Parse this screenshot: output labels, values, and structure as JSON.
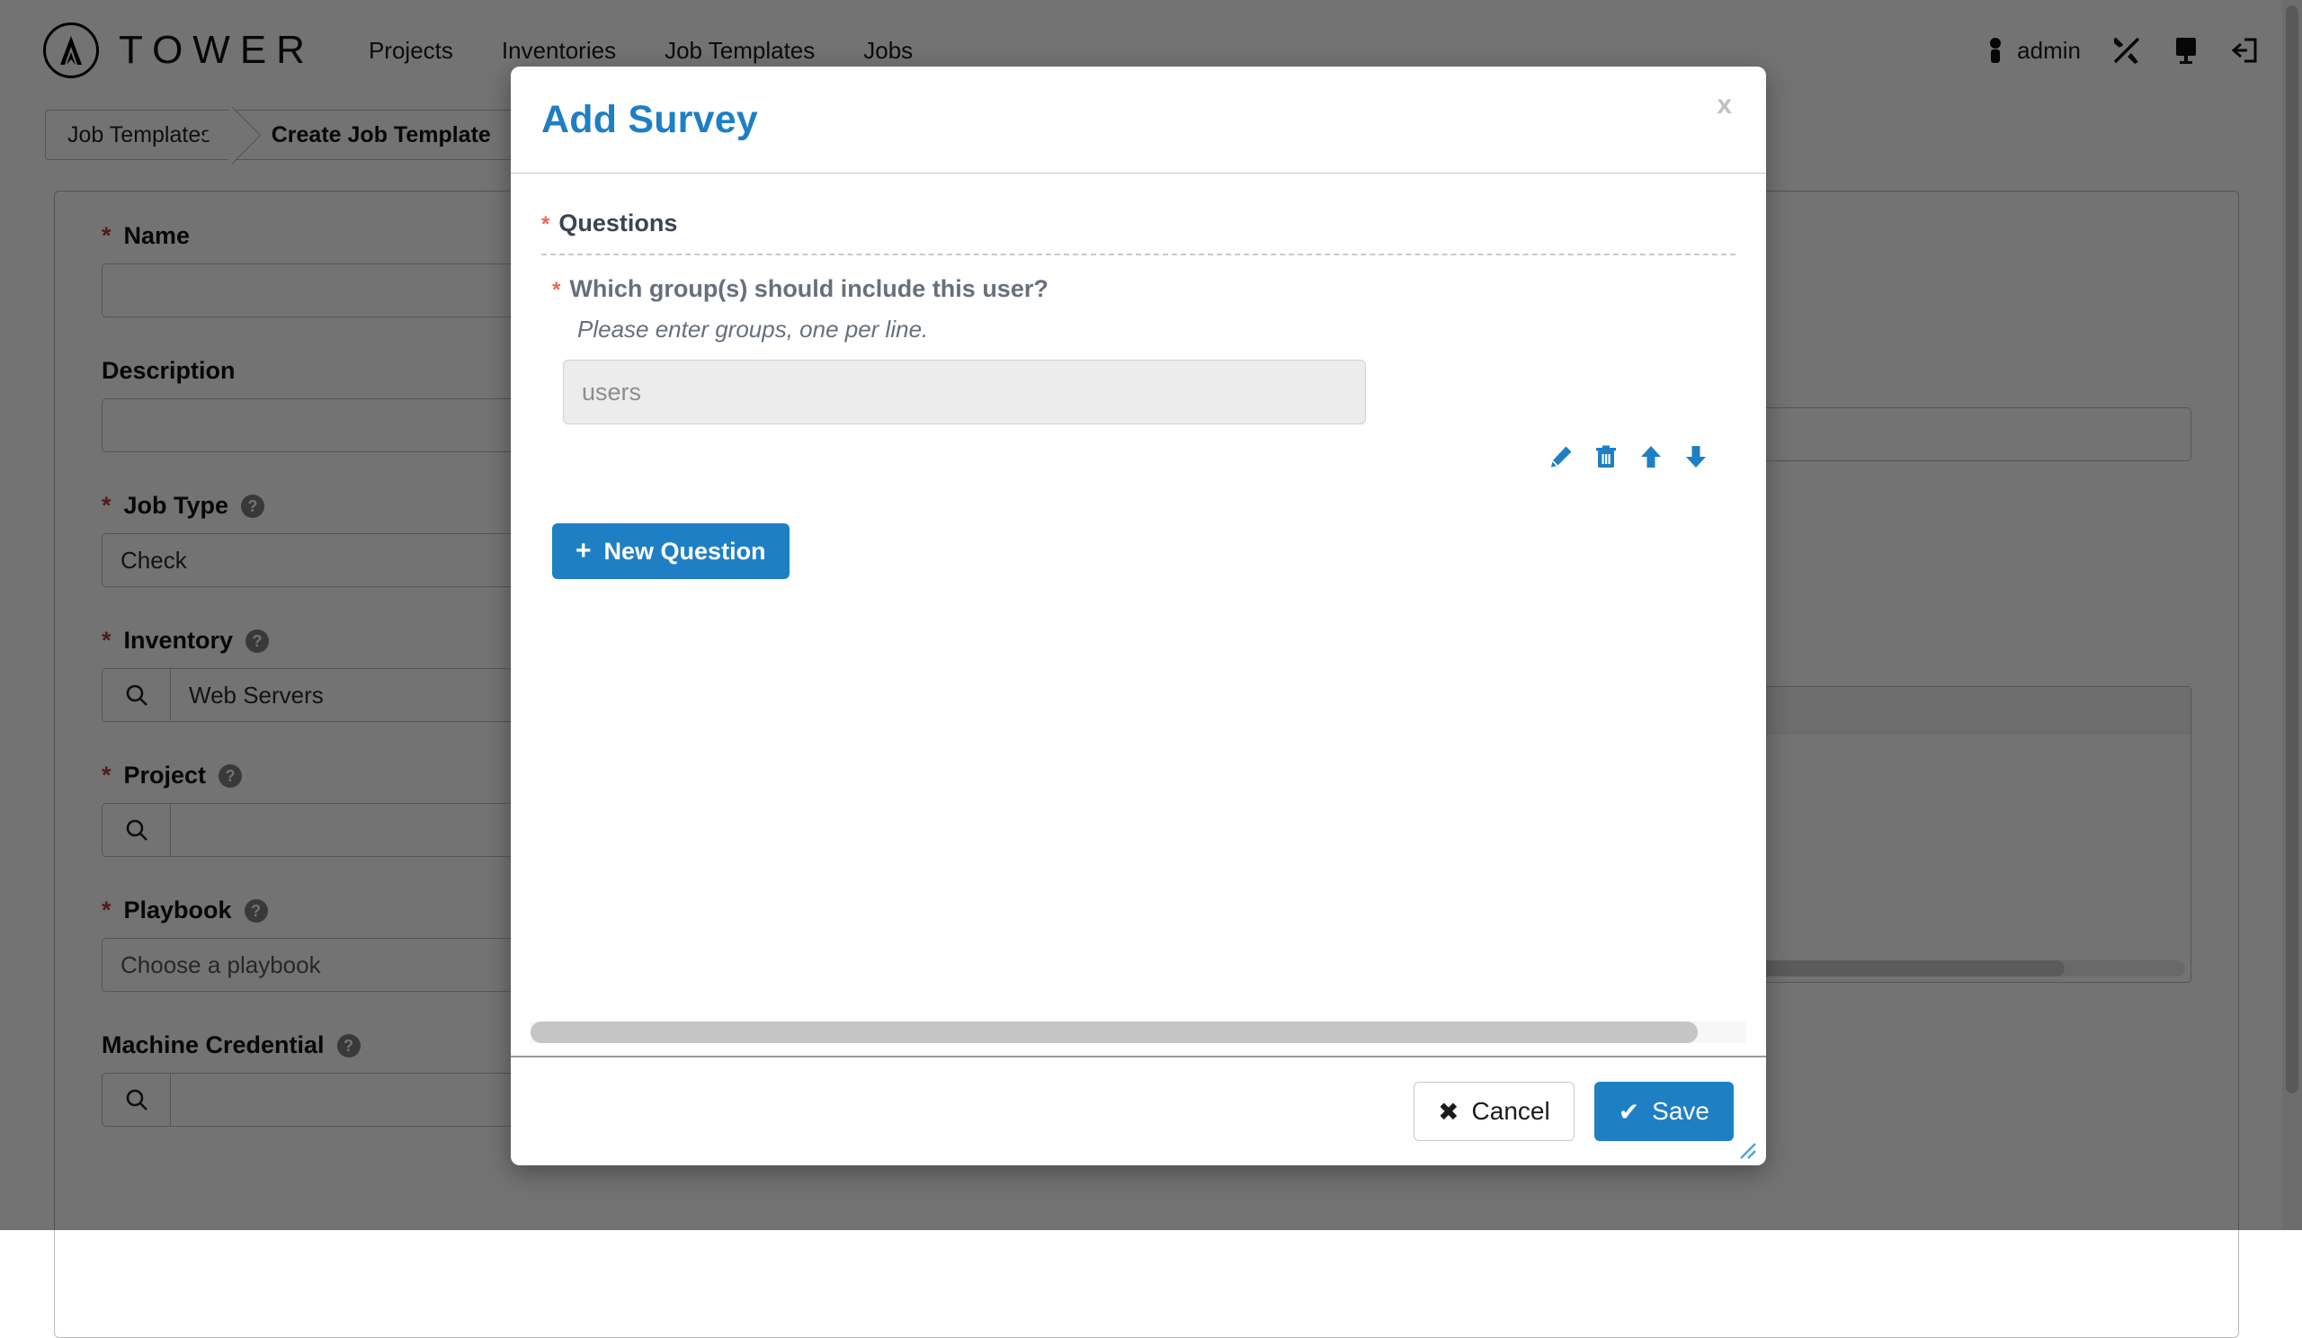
{
  "navbar": {
    "brand": "TOWER",
    "brand_icon": "tower-logo-icon",
    "links": [
      "Projects",
      "Inventories",
      "Job Templates",
      "Jobs"
    ],
    "user": "admin",
    "user_icon": "user-icon",
    "tools_icon": "wrench-screwdriver-icon",
    "monitor_icon": "monitor-icon",
    "logout_icon": "logout-icon"
  },
  "breadcrumb": {
    "parent": "Job Templates",
    "current": "Create Job Template"
  },
  "form": {
    "fields": [
      {
        "label": "Name",
        "required": true,
        "help": false,
        "value": "",
        "placeholder": ""
      },
      {
        "label": "Description",
        "required": false,
        "help": false,
        "value": "",
        "placeholder": ""
      },
      {
        "label": "Job Type",
        "required": true,
        "help": true,
        "value": "Check",
        "placeholder": ""
      },
      {
        "label": "Inventory",
        "required": true,
        "help": true,
        "value": "Web Servers",
        "placeholder": "",
        "search": true
      },
      {
        "label": "Project",
        "required": true,
        "help": true,
        "value": "",
        "placeholder": "",
        "search": true
      },
      {
        "label": "Playbook",
        "required": true,
        "help": true,
        "value": "",
        "placeholder": "Choose a playbook"
      },
      {
        "label": "Machine Credential",
        "required": false,
        "help": true,
        "value": "",
        "placeholder": "",
        "search": true
      }
    ],
    "help_glyph": "?",
    "search_icon": "search-icon"
  },
  "modal": {
    "title": "Add Survey",
    "close_label": "x",
    "close_icon": "close-icon",
    "questions_label": "Questions",
    "questions_required": true,
    "question": {
      "text": "Which group(s) should include this user?",
      "required": true,
      "help_text": "Please enter groups, one per line.",
      "answer_value": "users",
      "actions": [
        {
          "name": "edit-question-icon",
          "glyph": "pencil"
        },
        {
          "name": "delete-question-icon",
          "glyph": "trash"
        },
        {
          "name": "move-question-up-icon",
          "glyph": "arrow-up"
        },
        {
          "name": "move-question-down-icon",
          "glyph": "arrow-down"
        }
      ]
    },
    "new_question_label": "New Question",
    "new_question_plus": "+",
    "cancel_label": "Cancel",
    "cancel_glyph": "✖",
    "save_label": "Save",
    "save_glyph": "✔",
    "resize_handle": "resize-grip-icon"
  },
  "colors": {
    "accent_blue": "#1f7fc4",
    "required_red": "#f0655a",
    "question_text": "#66707c",
    "disabled_field_bg": "#ececec",
    "overlay": "rgba(0,0,0,0.55)"
  }
}
